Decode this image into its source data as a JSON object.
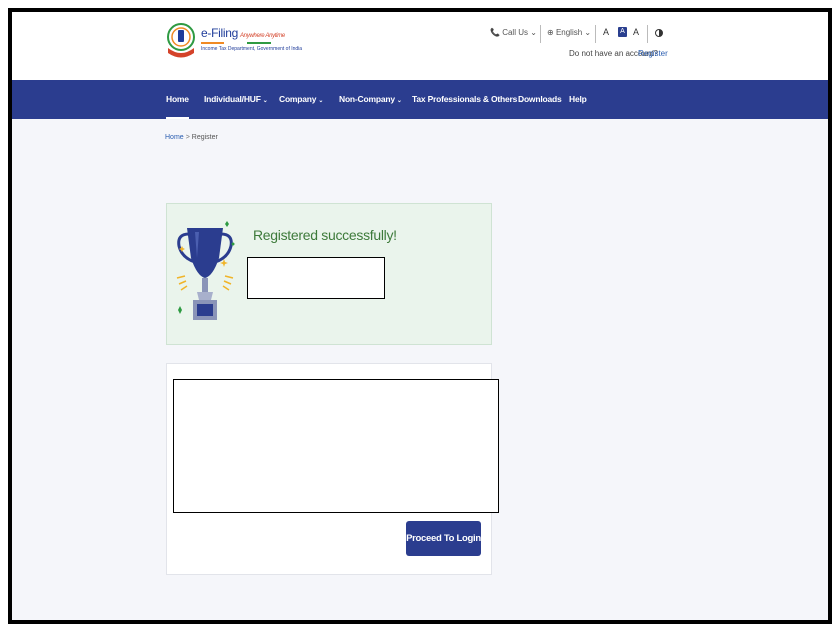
{
  "header": {
    "logo": {
      "title": "e-Filing",
      "tagline": "Anywhere Anytime",
      "subtitle": "Income Tax Department, Government of India"
    },
    "call_us": "Call Us",
    "language": "English",
    "font_sizes": [
      "A",
      "A",
      "A"
    ],
    "account_prompt": "Do not have an account?",
    "register_link": "Register"
  },
  "nav": {
    "items": [
      {
        "label": "Home",
        "has_dropdown": false,
        "active": true
      },
      {
        "label": "Individual/HUF",
        "has_dropdown": true
      },
      {
        "label": "Company",
        "has_dropdown": true
      },
      {
        "label": "Non-Company",
        "has_dropdown": true
      },
      {
        "label": "Tax Professionals & Others",
        "has_dropdown": true
      },
      {
        "label": "Downloads",
        "has_dropdown": false
      },
      {
        "label": "Help",
        "has_dropdown": false
      }
    ]
  },
  "breadcrumb": {
    "home": "Home",
    "separator": ">",
    "current": "Register"
  },
  "success": {
    "message": "Registered successfully!",
    "icon": "trophy-icon"
  },
  "actions": {
    "proceed_label": "Proceed To Login"
  },
  "colors": {
    "brand_blue": "#2b3d8f",
    "success_green": "#3d7a3a",
    "success_bg": "#eaf4ec",
    "link_blue": "#2a5db0"
  }
}
